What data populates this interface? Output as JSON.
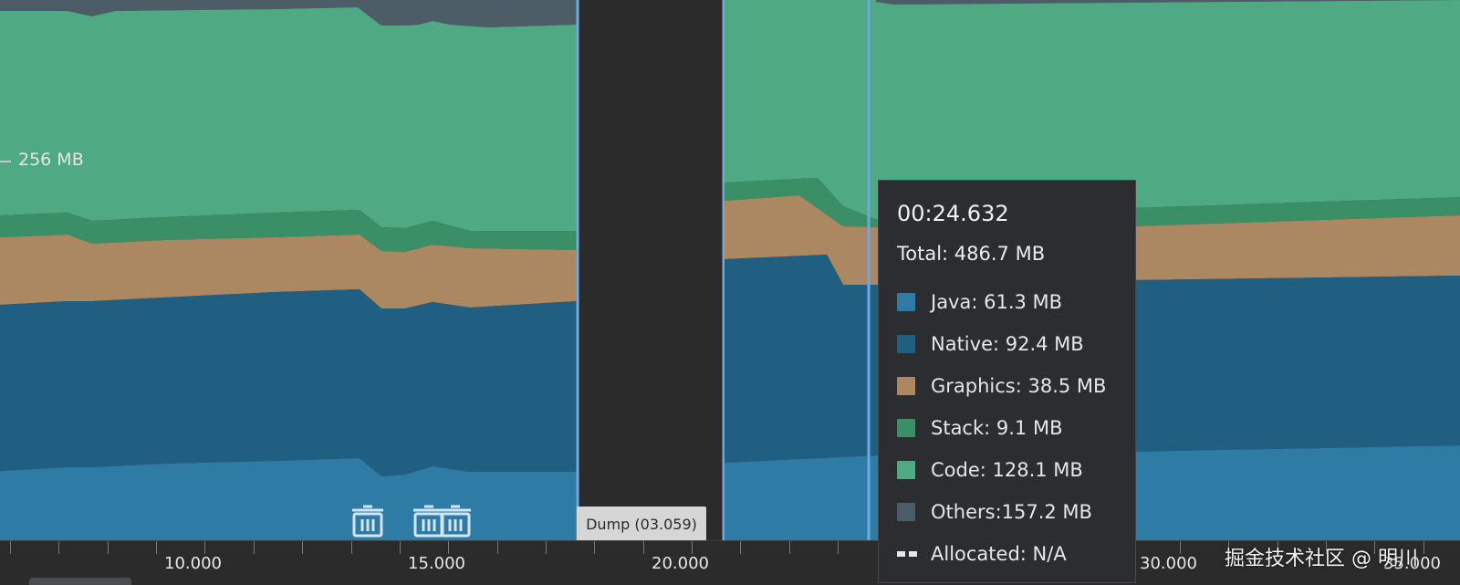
{
  "axis": {
    "y_label": "256 MB"
  },
  "dump": {
    "label": "Dump (03.059)"
  },
  "tooltip": {
    "time": "00:24.632",
    "total": "Total: 486.7 MB",
    "rows": [
      {
        "label": "Java: 61.3 MB",
        "color": "#2e7ba6"
      },
      {
        "label": "Native: 92.4 MB",
        "color": "#215f82"
      },
      {
        "label": "Graphics: 38.5 MB",
        "color": "#ab8762"
      },
      {
        "label": "Stack: 9.1 MB",
        "color": "#3a8f67"
      },
      {
        "label": "Code: 128.1 MB",
        "color": "#4faa83"
      },
      {
        "label": "Others:157.2 MB",
        "color": "#4d5d68"
      }
    ],
    "allocated": "Allocated: N/A"
  },
  "timeline": {
    "ticks": [
      "10.000",
      "15.000",
      "20.000",
      "30.000",
      "35.000"
    ]
  },
  "watermark": "掘金技术社区 @ 明川",
  "icons": {
    "gc": "trash-icon"
  },
  "colors": {
    "java": "#2e7ba6",
    "native": "#215f82",
    "graphics": "#ab8762",
    "stack": "#3a8f67",
    "code": "#4faa83",
    "others": "#4d5d68",
    "dump_band": "#2b2b2b",
    "selection_line": "#6ea8e0"
  }
}
